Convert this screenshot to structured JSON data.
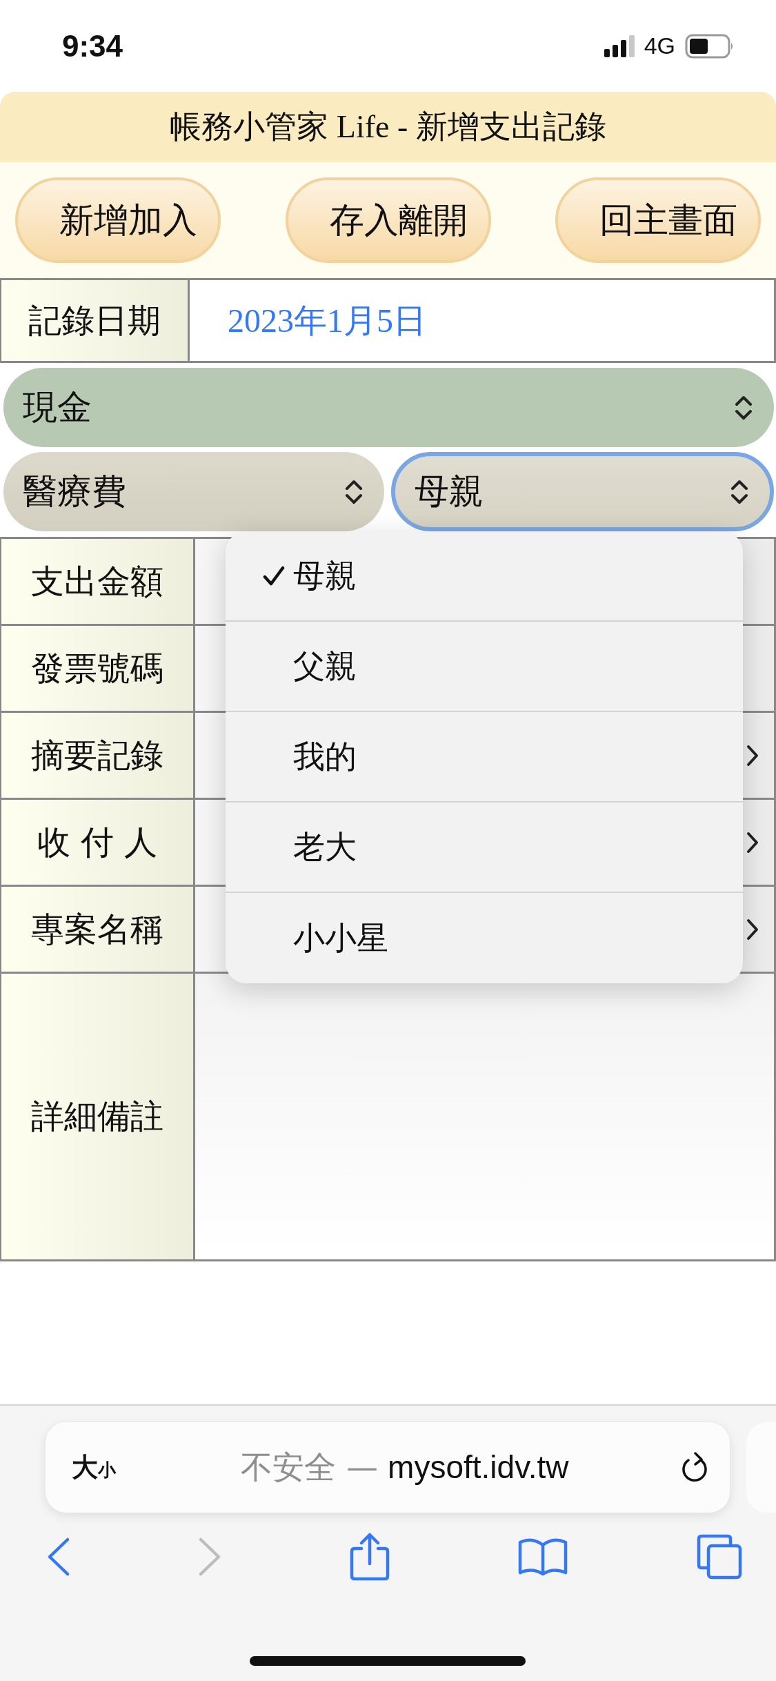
{
  "status_bar": {
    "time": "9:34",
    "network": "4G"
  },
  "header": {
    "title": "帳務小管家 Life - 新增支出記錄"
  },
  "buttons": [
    "新增加入",
    "存入離開",
    "回主畫面"
  ],
  "date_row": {
    "label": "記錄日期",
    "value": "2023年1月5日"
  },
  "account_select": {
    "value": "現金"
  },
  "category_select": {
    "value": "醫療費"
  },
  "member_select": {
    "value": "母親",
    "focused": true
  },
  "form_rows": [
    {
      "label": "支出金額",
      "kind": "text"
    },
    {
      "label": "發票號碼",
      "kind": "text"
    },
    {
      "label": "摘要記錄",
      "kind": "select"
    },
    {
      "label": "收 付 人",
      "kind": "select"
    },
    {
      "label": "專案名稱",
      "kind": "select"
    },
    {
      "label": "詳細備註",
      "kind": "textarea"
    }
  ],
  "dropdown_menu": {
    "options": [
      {
        "label": "母親",
        "selected": true
      },
      {
        "label": "父親",
        "selected": false
      },
      {
        "label": "我的",
        "selected": false
      },
      {
        "label": "老大",
        "selected": false
      },
      {
        "label": "小小星",
        "selected": false
      }
    ]
  },
  "browser": {
    "text_size": {
      "large": "大",
      "small": "小"
    },
    "security": "不安全 —",
    "domain": "mysoft.idv.tw",
    "forward_disabled": true
  }
}
